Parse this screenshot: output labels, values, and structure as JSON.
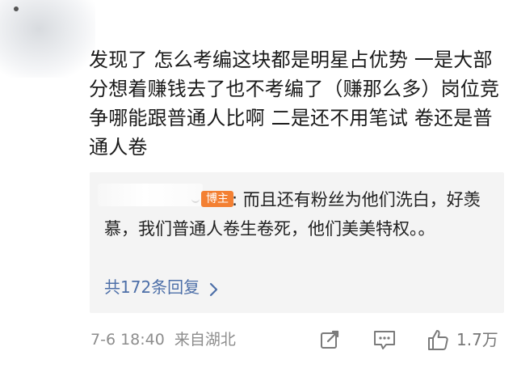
{
  "comment": {
    "text": "发现了 怎么考编这块都是明星占优势 一是大部分想着赚钱去了也不考编了（赚那么多）岗位竞争哪能跟普通人比啊 二是还不用笔试 卷还是普通人卷"
  },
  "reply": {
    "badge": "博主",
    "text": ": 而且还有粉丝为他们洗白，好羡慕，我们普通人卷生卷死，他们美美特权。。",
    "count_text": "共172条回复"
  },
  "footer": {
    "time": "7-6 18:40",
    "location": "来自湖北",
    "like_count": "1.7万"
  },
  "icons": {
    "share": "share-icon",
    "comment": "comment-icon",
    "like": "like-icon",
    "chevron": "chevron-right-icon"
  },
  "colors": {
    "badge": "#f38033",
    "link": "#4d6fa8",
    "meta": "#8d8d8d"
  }
}
